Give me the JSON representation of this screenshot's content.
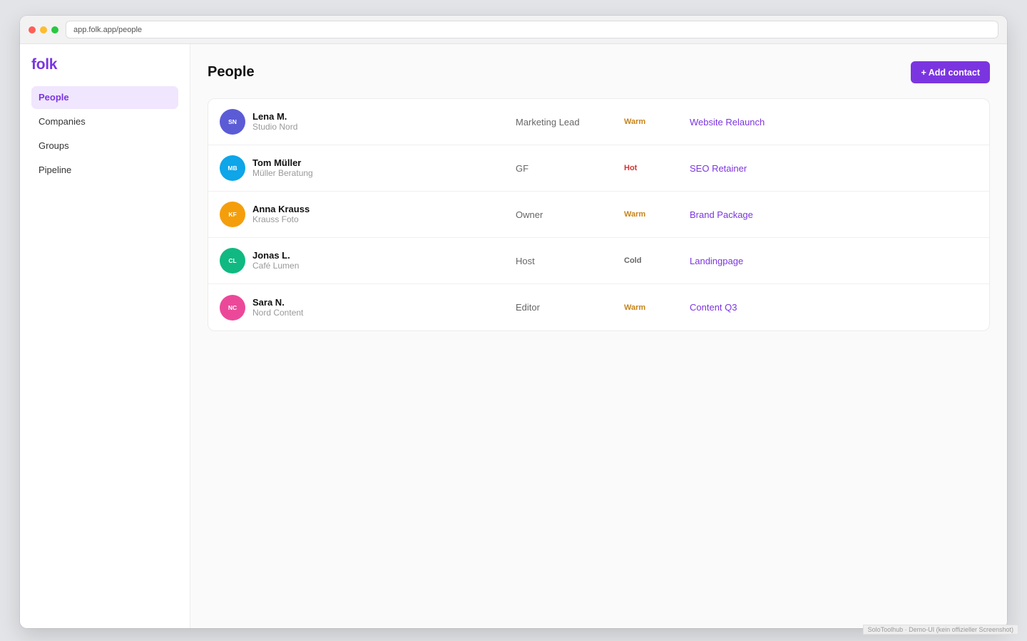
{
  "browser": {
    "url": "app.folk.app/people"
  },
  "sidebar": {
    "logo": "folk",
    "items": [
      {
        "label": "People"
      },
      {
        "label": "Companies"
      },
      {
        "label": "Groups"
      },
      {
        "label": "Pipeline"
      }
    ],
    "active": "People"
  },
  "main": {
    "title": "People",
    "add_button_label": "+ Add contact"
  },
  "contacts": [
    {
      "initials": "SN",
      "name": "Lena M.",
      "company": "Studio Nord",
      "role": "Marketing Lead",
      "status": "Warm",
      "deal": "Website Relaunch",
      "avatar_color": "#5b5bd6",
      "status_color": "#c8841a"
    },
    {
      "initials": "MB",
      "name": "Tom Müller",
      "company": "Müller Beratung",
      "role": "GF",
      "status": "Hot",
      "deal": "SEO Retainer",
      "avatar_color": "#0ea5e9",
      "status_color": "#d03434"
    },
    {
      "initials": "KF",
      "name": "Anna Krauss",
      "company": "Krauss Foto",
      "role": "Owner",
      "status": "Warm",
      "deal": "Brand Package",
      "avatar_color": "#f59e0b",
      "status_color": "#c8841a"
    },
    {
      "initials": "CL",
      "name": "Jonas L.",
      "company": "Café Lumen",
      "role": "Host",
      "status": "Cold",
      "deal": "Landingpage",
      "avatar_color": "#10b981",
      "status_color": "#666666"
    },
    {
      "initials": "NC",
      "name": "Sara N.",
      "company": "Nord Content",
      "role": "Editor",
      "status": "Warm",
      "deal": "Content Q3",
      "avatar_color": "#ec4899",
      "status_color": "#c8841a"
    }
  ],
  "colors": {
    "accent": "#7b35e0",
    "active_nav_bg": "#f0e6fd"
  },
  "footer_note": "SoloToolhub · Demo-UI (kein offizieller Screenshot)"
}
